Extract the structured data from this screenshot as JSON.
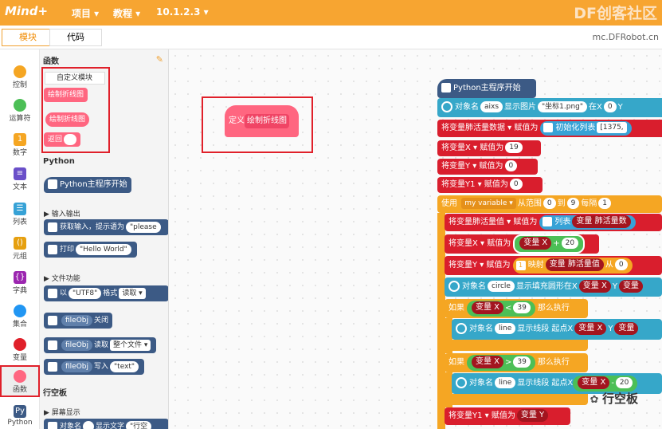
{
  "app": {
    "logo": "Mind+",
    "menu_project": "项目 ▾",
    "menu_tutorial": "教程 ▾",
    "version": "10.1.2.3 ▾",
    "brand": "DF创客社区",
    "site": "mc.DFRobot.cn"
  },
  "tabs": {
    "blocks": "模块",
    "code": "代码"
  },
  "categories": [
    {
      "label": "控制",
      "color": "#f5a623"
    },
    {
      "label": "运算符",
      "color": "#4cbf56"
    },
    {
      "label": "数字",
      "color": "#f5a623"
    },
    {
      "label": "文本",
      "color": "#6a4fc9"
    },
    {
      "label": "列表",
      "color": "#37a2d6"
    },
    {
      "label": "元组",
      "color": "#e6a010"
    },
    {
      "label": "字典",
      "color": "#9c27b0"
    },
    {
      "label": "集合",
      "color": "#2196f3"
    },
    {
      "label": "变量",
      "color": "#e0202a"
    },
    {
      "label": "函数",
      "color": "#ff6680"
    },
    {
      "label": "Python",
      "color": "#3c5a85"
    }
  ],
  "palette": {
    "func_header": "函数",
    "custom_module": "自定义模块",
    "draw_line1": "绘制折线图",
    "draw_line2": "绘制折线图",
    "return_label": "返回",
    "python_header": "Python",
    "py_start": "Python主程序开始",
    "io_section": "▶ 输入输出",
    "input_label": "获取输入，提示语为",
    "input_default": "\"please",
    "print_label": "打印",
    "print_default": "\"Hello World\"",
    "file_section": "▶ 文件功能",
    "open_with": "以",
    "utf8": "\"UTF8\"",
    "fmt_label": "格式",
    "read_label": "读取 ▾",
    "fileobj": "fileObj",
    "close_label": "关闭",
    "read_mode": "读取",
    "whole_file": "整个文件 ▾",
    "write_label": "写入",
    "text_default": "\"text\"",
    "dash_header": "行空板",
    "screen_section": "▶ 屏幕显示",
    "obj_name": "对象名",
    "show_text": "显示文字",
    "text_trunc": "\"行空"
  },
  "canvas": {
    "def_label": "定义",
    "def_name": "绘制折线图",
    "py_start": "Python主程序开始",
    "obj_name": "对象名",
    "aixs": "aixs",
    "show_image": "显示图片",
    "img_file": "\"坐标1.png\"",
    "at_x": "在X",
    "zero": "0",
    "y_label": "Y",
    "set_var": "将变量",
    "bar_data": "肺活量数据 ▾",
    "assign": "赋值为",
    "init_list": "初始化列表",
    "list_vals": "[1375,",
    "x_var": "X ▾",
    "y_var": "Y ▾",
    "y1_var": "Y1 ▾",
    "v19": "19",
    "v0a": "0",
    "v0b": "0",
    "use": "使用",
    "my_var": "my variable ▾",
    "range_from": "从范围",
    "r0": "0",
    "to": "到",
    "r9": "9",
    "step": "每隔",
    "r1": "1",
    "bar_val": "肺活量值 ▾",
    "list_label": "列表",
    "var_bar_data": "变量 肺活量数",
    "var_x": "变量 X",
    "plus": "+",
    "v20": "20",
    "map_label": "映射",
    "var_bar": "变量 肺活量值",
    "from_label": "从",
    "f0": "0",
    "circle": "circle",
    "draw_circle": "显示填充圆形在X",
    "var_y": "变量 Y",
    "var_trunc": "变量",
    "if": "如果",
    "lt": "<",
    "gt": ">",
    "v39a": "39",
    "v39b": "39",
    "then": "那么执行",
    "line": "line",
    "draw_line": "显示线段 起点X",
    "minus": "-",
    "v20b": "20",
    "y1_assign_var": "变量 Y"
  },
  "watermark": "行空板"
}
